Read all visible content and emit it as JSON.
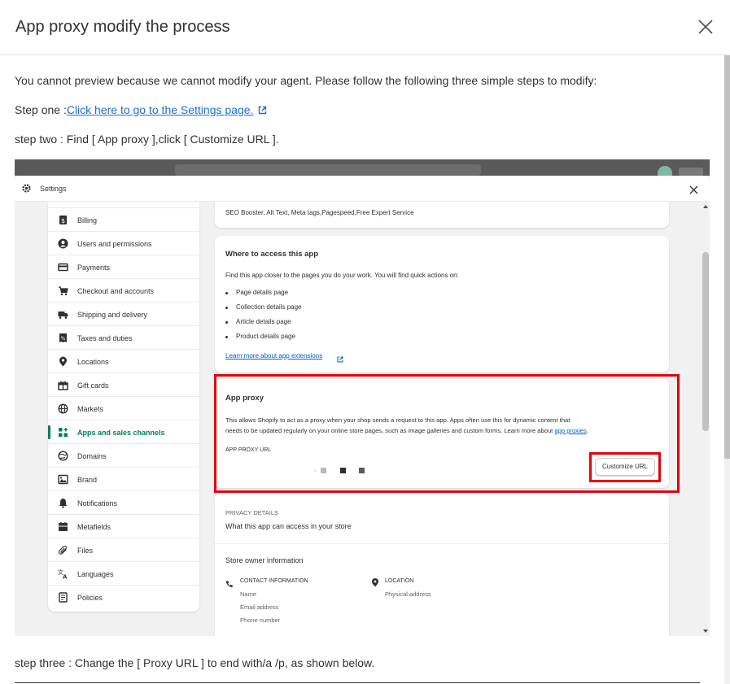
{
  "modal": {
    "title": "App proxy modify the process"
  },
  "intro_text": "You cannot preview because we cannot modify your agent. Please follow the following three simple steps to modify:",
  "step_one": {
    "prefix": "Step one :",
    "link_text": "Click here to go to the Settings page."
  },
  "step_two": "step two : Find [ App proxy ],click [ Customize URL ].",
  "step_three": "step three : Change the [ Proxy URL ] to end with/a /p, as shown below.",
  "screenshot": {
    "settings_title": "Settings",
    "nav_items": [
      {
        "label": "Billing",
        "icon": "billing-icon",
        "active": false
      },
      {
        "label": "Users and permissions",
        "icon": "user-icon",
        "active": false
      },
      {
        "label": "Payments",
        "icon": "payments-icon",
        "active": false
      },
      {
        "label": "Checkout and accounts",
        "icon": "cart-icon",
        "active": false
      },
      {
        "label": "Shipping and delivery",
        "icon": "truck-icon",
        "active": false
      },
      {
        "label": "Taxes and duties",
        "icon": "tax-icon",
        "active": false
      },
      {
        "label": "Locations",
        "icon": "location-icon",
        "active": false
      },
      {
        "label": "Gift cards",
        "icon": "gift-icon",
        "active": false
      },
      {
        "label": "Markets",
        "icon": "globe-icon",
        "active": false
      },
      {
        "label": "Apps and sales channels",
        "icon": "apps-icon",
        "active": true
      },
      {
        "label": "Domains",
        "icon": "domain-icon",
        "active": false
      },
      {
        "label": "Brand",
        "icon": "brand-icon",
        "active": false
      },
      {
        "label": "Notifications",
        "icon": "bell-icon",
        "active": false
      },
      {
        "label": "Metafields",
        "icon": "metafields-icon",
        "active": false
      },
      {
        "label": "Files",
        "icon": "paperclip-icon",
        "active": false
      },
      {
        "label": "Languages",
        "icon": "language-icon",
        "active": false
      },
      {
        "label": "Policies",
        "icon": "policy-icon",
        "active": false
      }
    ],
    "top_card_text": "SEO Booster, Alt Text, Meta tags,Pagespeed,Free Expert Service",
    "access": {
      "title": "Where to access this app",
      "description": "Find this app closer to the pages you do your work. You will find quick actions on:",
      "bullets": [
        "Page details page",
        "Collection details page",
        "Article details page",
        "Product details page"
      ],
      "link": "Learn more about app extensions"
    },
    "proxy": {
      "title": "App proxy",
      "description_line1": "This allows Shopify to act as a proxy when your shop sends a request to this app. Apps often use this for dynamic content that",
      "description_line2": "needs to be updated regularly on your online store pages, such as image galleries and custom forms. Learn more about",
      "description_link": "app proxies",
      "description_end": ".",
      "url_label": "APP PROXY URL",
      "button": "Customize URL"
    },
    "privacy": {
      "label": "PRIVACY DETAILS",
      "title": "What this app can access in your store"
    },
    "store_owner": {
      "title": "Store owner information",
      "contact_label": "CONTACT INFORMATION",
      "contact_items": [
        "Name",
        "Email address",
        "Phone number"
      ],
      "location_label": "LOCATION",
      "location_items": [
        "Physical address"
      ]
    },
    "highlight_color": "#e8000b",
    "active_color": "#00805a"
  }
}
